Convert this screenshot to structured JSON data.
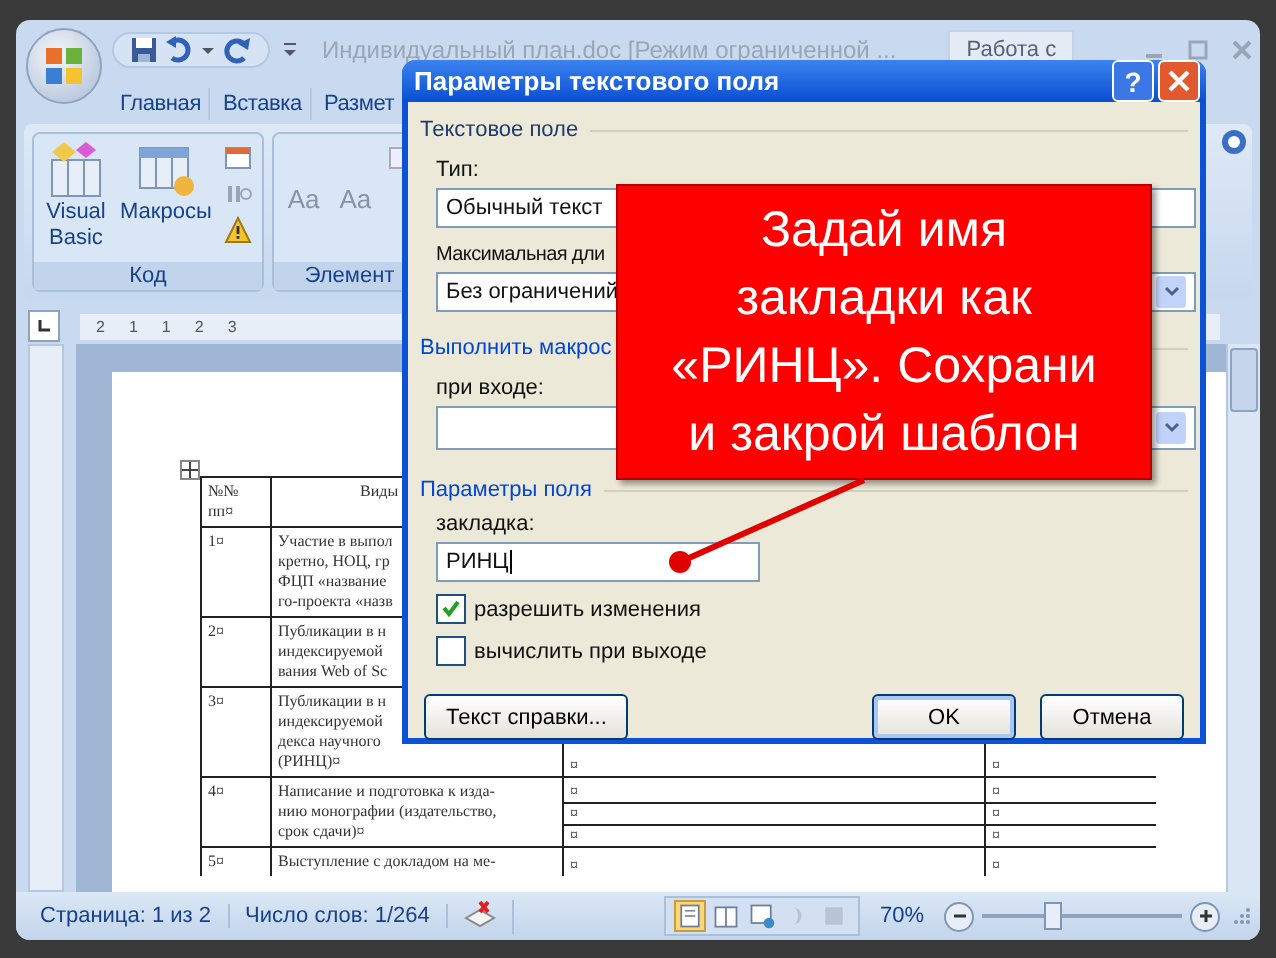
{
  "window": {
    "title": "Индивидуальный план.doc [Режим ограниченной ...",
    "context_tab": "Работа с"
  },
  "ribbon": {
    "tabs": [
      {
        "label": "Главная",
        "selected": false
      },
      {
        "label": "Вставка",
        "selected": false
      },
      {
        "label": "Размет",
        "selected": false
      }
    ],
    "groups": [
      {
        "label": "Код",
        "buttons": [
          {
            "label": "Visual Basic",
            "kind": "vb"
          },
          {
            "label": "Макросы",
            "kind": "macros"
          }
        ]
      },
      {
        "label": "Элемент",
        "buttons": [
          {
            "label": "Aa",
            "kind": "text"
          },
          {
            "label": "Aa",
            "kind": "text"
          }
        ]
      }
    ]
  },
  "ruler": {
    "labels": [
      "2",
      "1",
      "1",
      "2",
      "3"
    ]
  },
  "table": {
    "header": {
      "number": [
        "№№",
        "пп¤"
      ],
      "title": "Виды"
    },
    "rows": [
      {
        "number": "1¤",
        "lines": [
          "Участие в выпол",
          "кретно, НОЦ, гр",
          "ФЦП «название",
          "го-проекта «назв"
        ],
        "col3": [],
        "col4": []
      },
      {
        "number": "2¤",
        "lines": [
          "Публикации в н",
          "индексируемой",
          "вания Web of Sc"
        ],
        "col3": [],
        "col4": []
      },
      {
        "number": "3¤",
        "lines": [
          "Публикации в н",
          "индексируемой",
          "декса научного",
          "(РИНЦ)¤"
        ],
        "col3": [
          "¤"
        ],
        "col4": [
          "¤"
        ]
      },
      {
        "number": "4¤",
        "lines": [
          "Написание и подготовка к изда-",
          "нию монографии (издательство,",
          "срок сдачи)¤"
        ],
        "col3": [
          "¤",
          "¤",
          "¤"
        ],
        "col4": [
          "¤",
          "¤",
          "¤"
        ]
      },
      {
        "number": "5¤",
        "lines": [
          "Выступление с докладом на ме-"
        ],
        "col3": [
          "¤"
        ],
        "col4": [
          "¤"
        ]
      }
    ]
  },
  "dialog": {
    "title": "Параметры текстового поля",
    "help_label": "?",
    "text_field_group": "Текстовое поле",
    "type_label": "Тип:",
    "type_value": "Обычный текст",
    "max_length_label": "Максимальная дли",
    "max_length_value": "Без ограничений",
    "macro_group": "Выполнить макрос",
    "on_entry_label": "при входе:",
    "field_group": "Параметры поля",
    "bookmark_label": "закладка:",
    "bookmark_value": "РИНЦ",
    "checkboxes": [
      {
        "label": "разрешить изменения",
        "checked": true
      },
      {
        "label": "вычислить при выходе",
        "checked": false
      }
    ],
    "buttons": [
      {
        "label": "Текст справки...",
        "default": false
      },
      {
        "label": "OK",
        "default": true
      },
      {
        "label": "Отмена",
        "default": false
      }
    ]
  },
  "callout": {
    "lines": [
      "Задай имя",
      "закладки как",
      "«РИНЦ». Сохрани",
      "и закрой шаблон"
    ]
  },
  "status_bar": {
    "page": "Страница: 1 из 2",
    "words": "Число слов: 1/264",
    "views": [
      {
        "selected": true
      },
      {
        "selected": false
      },
      {
        "selected": false
      },
      {
        "selected": false
      },
      {
        "selected": false
      }
    ],
    "zoom": "70%",
    "zoom_slider": {
      "level": 0.35
    }
  }
}
